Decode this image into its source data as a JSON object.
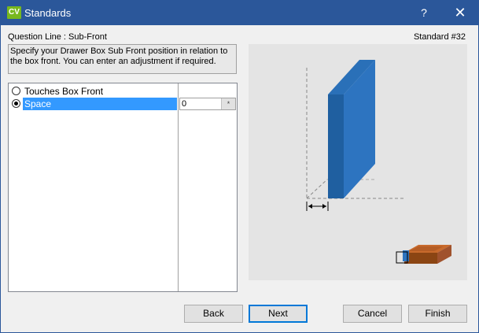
{
  "window": {
    "title": "Standards",
    "app_icon_text": "CV",
    "help_label": "?",
    "close_label": "✕"
  },
  "header": {
    "question_line": "Question Line : Sub-Front",
    "standard_number": "Standard #32"
  },
  "description": "Specify your Drawer Box Sub Front position in relation to the box front. You can enter an adjustment if required.",
  "options": [
    {
      "label": "Touches Box Front",
      "selected": false
    },
    {
      "label": "Space",
      "selected": true,
      "value": "0",
      "spin_label": "*"
    }
  ],
  "buttons": {
    "back": "Back",
    "next": "Next",
    "cancel": "Cancel",
    "finish": "Finish"
  },
  "colors": {
    "titlebar": "#2b579a",
    "selection": "#3399ff",
    "panel_blue": "#2d6db4",
    "drawer_brown": "#a0522d"
  }
}
